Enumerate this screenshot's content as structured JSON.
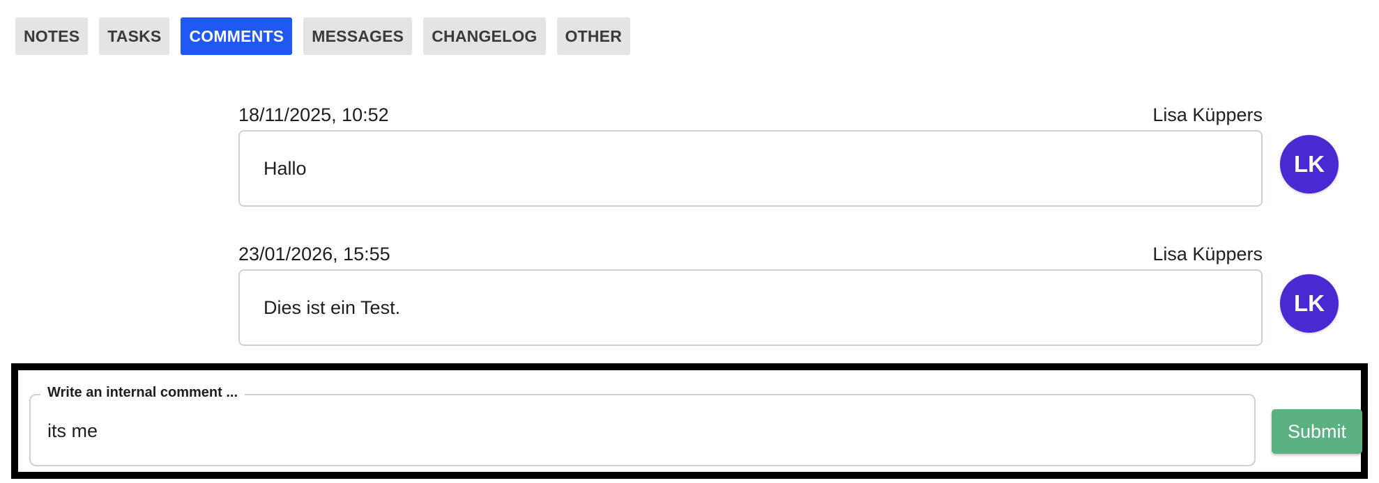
{
  "tabs": [
    {
      "label": "NOTES",
      "active": false
    },
    {
      "label": "TASKS",
      "active": false
    },
    {
      "label": "COMMENTS",
      "active": true
    },
    {
      "label": "MESSAGES",
      "active": false
    },
    {
      "label": "CHANGELOG",
      "active": false
    },
    {
      "label": "OTHER",
      "active": false
    }
  ],
  "comments": [
    {
      "timestamp": "18/11/2025, 10:52",
      "author": "Lisa Küppers",
      "text": "Hallo",
      "initials": "LK"
    },
    {
      "timestamp": "23/01/2026, 15:55",
      "author": "Lisa Küppers",
      "text": "Dies ist ein Test.",
      "initials": "LK"
    }
  ],
  "composer": {
    "label": "Write an internal comment ...",
    "value": "its me",
    "submit_label": "Submit"
  },
  "colors": {
    "active_tab": "#2157f2",
    "inactive_tab": "#e4e4e4",
    "avatar": "#4a29d2",
    "submit": "#5bb182"
  }
}
